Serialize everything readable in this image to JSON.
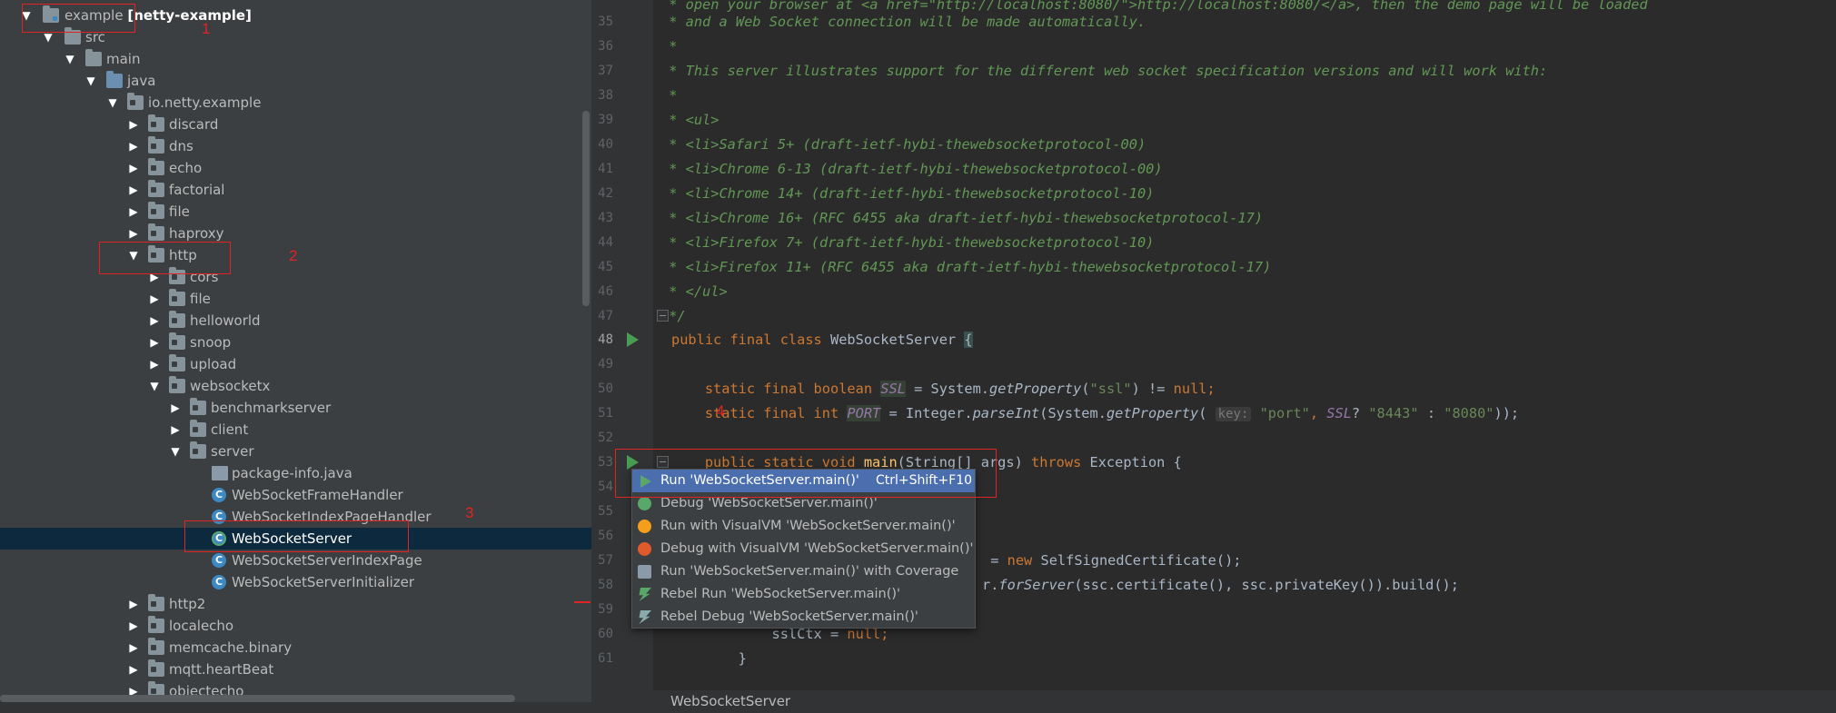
{
  "tree": {
    "rows": [
      {
        "pre": "example ",
        "bold": "[netty-example]",
        "arrow": "▼",
        "icon": "module-folder-icon"
      },
      {
        "label": "src",
        "arrow": "▼",
        "icon": "folder-icon"
      },
      {
        "label": "main",
        "arrow": "▼",
        "icon": "folder-icon"
      },
      {
        "label": "java",
        "arrow": "▼",
        "icon": "source-folder-icon"
      },
      {
        "label": "io.netty.example",
        "arrow": "▼",
        "icon": "package-icon"
      },
      {
        "label": "discard",
        "arrow": "▶",
        "icon": "package-icon"
      },
      {
        "label": "dns",
        "arrow": "▶",
        "icon": "package-icon"
      },
      {
        "label": "echo",
        "arrow": "▶",
        "icon": "package-icon"
      },
      {
        "label": "factorial",
        "arrow": "▶",
        "icon": "package-icon"
      },
      {
        "label": "file",
        "arrow": "▶",
        "icon": "package-icon"
      },
      {
        "label": "haproxy",
        "arrow": "▶",
        "icon": "package-icon"
      },
      {
        "label": "http",
        "arrow": "▼",
        "icon": "package-icon"
      },
      {
        "label": "cors",
        "arrow": "▶",
        "icon": "package-icon"
      },
      {
        "label": "file",
        "arrow": "▶",
        "icon": "package-icon"
      },
      {
        "label": "helloworld",
        "arrow": "▶",
        "icon": "package-icon"
      },
      {
        "label": "snoop",
        "arrow": "▶",
        "icon": "package-icon"
      },
      {
        "label": "upload",
        "arrow": "▶",
        "icon": "package-icon"
      },
      {
        "label": "websocketx",
        "arrow": "▼",
        "icon": "package-icon"
      },
      {
        "label": "benchmarkserver",
        "arrow": "▶",
        "icon": "package-icon"
      },
      {
        "label": "client",
        "arrow": "▶",
        "icon": "package-icon"
      },
      {
        "label": "server",
        "arrow": "▼",
        "icon": "package-icon"
      },
      {
        "label": "package-info.java",
        "arrow": "",
        "icon": "java-file-icon"
      },
      {
        "label": "WebSocketFrameHandler",
        "arrow": "",
        "icon": "class-icon"
      },
      {
        "label": "WebSocketIndexPageHandler",
        "arrow": "",
        "icon": "class-icon"
      },
      {
        "label": "WebSocketServer",
        "arrow": "",
        "icon": "runnable-class-icon"
      },
      {
        "label": "WebSocketServerIndexPage",
        "arrow": "",
        "icon": "class-icon"
      },
      {
        "label": "WebSocketServerInitializer",
        "arrow": "",
        "icon": "class-icon"
      },
      {
        "label": "http2",
        "arrow": "▶",
        "icon": "package-icon"
      },
      {
        "label": "localecho",
        "arrow": "▶",
        "icon": "package-icon"
      },
      {
        "label": "memcache.binary",
        "arrow": "▶",
        "icon": "package-icon"
      },
      {
        "label": "mqtt.heartBeat",
        "arrow": "▶",
        "icon": "package-icon"
      },
      {
        "label": "objectecho",
        "arrow": "▶",
        "icon": "package-icon"
      }
    ]
  },
  "annotations": [
    "1",
    "2",
    "3",
    "4"
  ],
  "editor": {
    "line_numbers": [
      "35",
      "36",
      "37",
      "38",
      "39",
      "40",
      "41",
      "42",
      "43",
      "44",
      "45",
      "46",
      "47",
      "48",
      "49",
      "50",
      "51",
      "52",
      "53",
      "54",
      "55",
      "56",
      "57",
      "58",
      "59",
      "60",
      "61"
    ],
    "top_partial": " * open your browser at <a href=\"http://localhost:8080/\">http://localhost:8080/</a>, then the demo page will be loaded",
    "c35": " * and a Web Socket connection will be made automatically.",
    "c36": " *",
    "c37": " * This server illustrates support for the different web socket specification versions and will work with:",
    "c38": " *",
    "c39": " * <ul>",
    "c40": " * <li>Safari 5+ (draft-ietf-hybi-thewebsocketprotocol-00)",
    "c41": " * <li>Chrome 6-13 (draft-ietf-hybi-thewebsocketprotocol-00)",
    "c42": " * <li>Chrome 14+ (draft-ietf-hybi-thewebsocketprotocol-10)",
    "c43": " * <li>Chrome 16+ (RFC 6455 aka draft-ietf-hybi-thewebsocketprotocol-17)",
    "c44": " * <li>Firefox 7+ (draft-ietf-hybi-thewebsocketprotocol-10)",
    "c45": " * <li>Firefox 11+ (RFC 6455 aka draft-ietf-hybi-thewebsocketprotocol-17)",
    "c46": " * </ul>",
    "c47": " */",
    "c48": {
      "kw": "public final class ",
      "name": "WebSocketServer ",
      "brace": "{"
    },
    "c50": {
      "kw": "    static final boolean ",
      "fld": "SSL",
      "rest1": " = System.",
      "fn": "getProperty",
      "p1": "(",
      "s1": "\"ssl\"",
      "rest2": ") != ",
      "kw2": "null",
      "semi": ";"
    },
    "c51": {
      "kw": "    static final int ",
      "fld": "PORT",
      "rest1": " = Integer.",
      "fn": "parseInt",
      "p1": "(System.",
      "fn2": "getProperty",
      "p2": "( ",
      "hint": "key:",
      "s1": " \"port\"",
      "c": ", ",
      "fld2": "SSL",
      "q": "? ",
      "s2": "\"8443\"",
      "colon": " : ",
      "s3": "\"8080\"",
      "end": "));"
    },
    "c53": {
      "kw": "    public static void ",
      "fn": "main",
      "rest": "(String[] args) ",
      "kw2": "throws",
      "rest2": " Exception {"
    },
    "c57": {
      "pre": "",
      "rest": " = ",
      "kw": "new",
      "rest2": " SelfSignedCertificate();"
    },
    "c58": {
      "rest": "r.",
      "fn": "forServer",
      "rest2": "(ssc.certificate(), ssc.privateKey()).build();"
    },
    "c60": {
      "rest": "            sslCtx = ",
      "kw": "null",
      "semi": ";"
    },
    "c61": "        }",
    "breadcrumb": "WebSocketServer"
  },
  "popup": {
    "items": [
      {
        "label": "Run 'WebSocketServer.main()'",
        "shortcut": "Ctrl+Shift+F10",
        "icon": "run-icon"
      },
      {
        "label": "Debug 'WebSocketServer.main()'",
        "icon": "debug-icon"
      },
      {
        "label": "Run with VisualVM 'WebSocketServer.main()'",
        "icon": "visualvm-run-icon"
      },
      {
        "label": "Debug with VisualVM 'WebSocketServer.main()'",
        "icon": "visualvm-debug-icon"
      },
      {
        "label": "Run 'WebSocketServer.main()' with Coverage",
        "icon": "coverage-icon"
      },
      {
        "label": "Rebel Run 'WebSocketServer.main()'",
        "icon": "rebel-run-icon"
      },
      {
        "label": "Rebel Debug 'WebSocketServer.main()'",
        "icon": "rebel-debug-icon"
      }
    ]
  },
  "colors": {
    "selection": "#0d293e",
    "menu_selection": "#4b6eaf",
    "annotation": "#e02424",
    "run_green": "#499c54"
  }
}
